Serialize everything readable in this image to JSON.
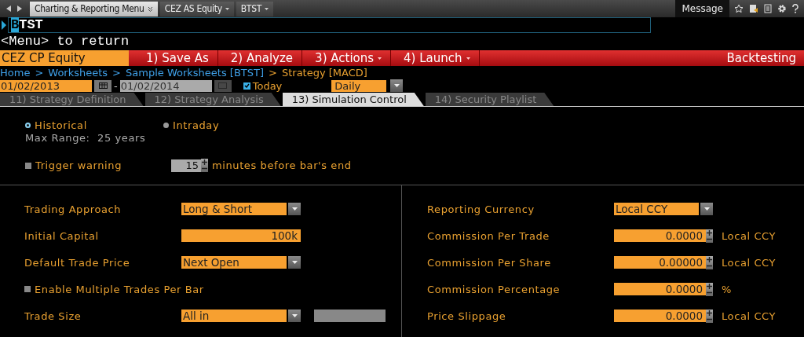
{
  "top_bar": {
    "tabs": [
      {
        "label": "Charting & Reporting Menu",
        "kind": "menu"
      },
      {
        "label": "CEZ AS Equity",
        "kind": "dropdown"
      },
      {
        "label": "BTST",
        "kind": "dropdown"
      }
    ],
    "message": "Message"
  },
  "command": {
    "value": "BTST",
    "hint": "<Menu> to return"
  },
  "action_bar": {
    "security": "CEZ CP Equity",
    "buttons": [
      {
        "label": "1) Save As",
        "dropdown": false
      },
      {
        "label": "2) Analyze",
        "dropdown": false
      },
      {
        "label": "3) Actions",
        "dropdown": true
      },
      {
        "label": "4) Launch",
        "dropdown": true
      }
    ],
    "title": "Backtesting"
  },
  "breadcrumb": [
    {
      "text": "Home",
      "kind": "link"
    },
    {
      "text": ">",
      "kind": "sep"
    },
    {
      "text": "Worksheets",
      "kind": "link"
    },
    {
      "text": ">",
      "kind": "sep"
    },
    {
      "text": "Sample Worksheets [BTST]",
      "kind": "link"
    },
    {
      "text": ">",
      "kind": "current"
    },
    {
      "text": "Strategy [MACD]",
      "kind": "current"
    }
  ],
  "dates": {
    "start": "01/02/2013",
    "separator": "-",
    "end": "01/02/2014",
    "end_disabled": true,
    "today_checked": true,
    "today_label": "Today",
    "period": "Daily"
  },
  "tabs": [
    {
      "label": "11) Strategy Definition",
      "selected": false
    },
    {
      "label": "12) Strategy Analysis",
      "selected": false
    },
    {
      "label": "13) Simulation Control",
      "selected": true
    },
    {
      "label": "14) Security Playlist",
      "selected": false
    }
  ],
  "mode": {
    "options": [
      {
        "label": "Historical",
        "selected": true
      },
      {
        "label": "Intraday",
        "selected": false
      }
    ],
    "max_range": "Max Range:  25 years",
    "trigger": {
      "label": "Trigger warning",
      "checked": false,
      "value": "15",
      "suffix": "minutes before bar's end"
    }
  },
  "left_settings": [
    {
      "kind": "dropdown",
      "label": "Trading Approach",
      "value": "Long & Short"
    },
    {
      "kind": "number",
      "label": "Initial Capital",
      "value": "100k"
    },
    {
      "kind": "dropdown",
      "label": "Default Trade Price",
      "value": "Next Open"
    },
    {
      "kind": "checkbox",
      "label": "Enable Multiple Trades Per Bar",
      "checked": false
    },
    {
      "kind": "dropdown_extra",
      "label": "Trade Size",
      "value": "All in"
    }
  ],
  "right_settings": [
    {
      "kind": "dropdown",
      "label": "Reporting Currency",
      "value": "Local CCY"
    },
    {
      "kind": "spinner",
      "label": "Commission Per Trade",
      "value": "0.0000",
      "unit": "Local CCY"
    },
    {
      "kind": "spinner",
      "label": "Commission Per Share",
      "value": "0.00000",
      "unit": "Local CCY"
    },
    {
      "kind": "spinner",
      "label": "Commission Percentage",
      "value": "0.0000",
      "unit": "%"
    },
    {
      "kind": "spinner",
      "label": "Price Slippage",
      "value": "0.0000",
      "unit": "Local CCY"
    }
  ]
}
